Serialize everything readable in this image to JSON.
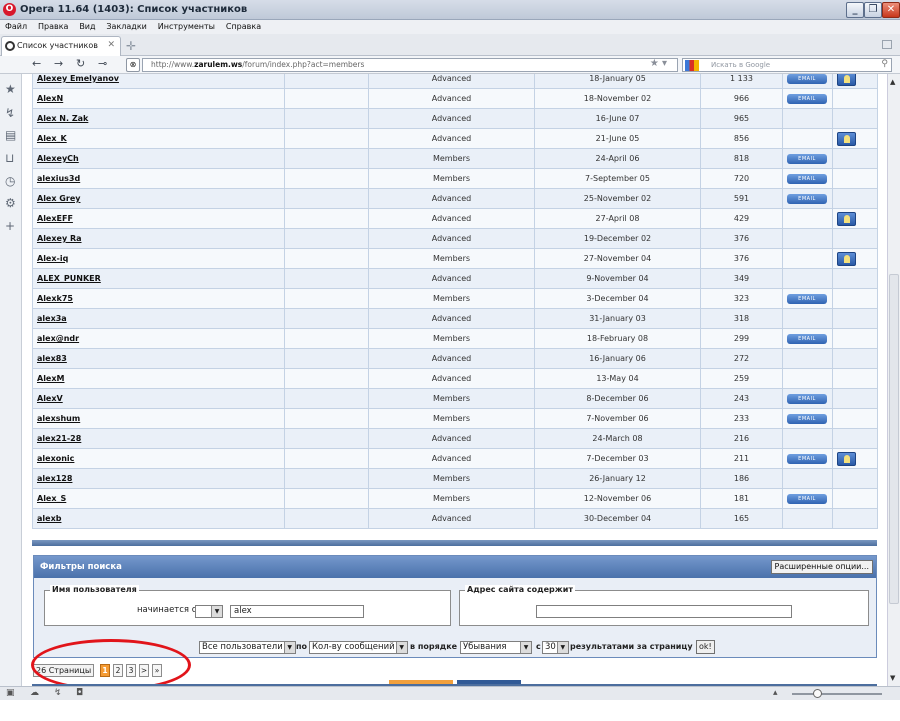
{
  "window": {
    "title": "Opera 11.64 (1403): Список участников"
  },
  "menu": [
    "Файл",
    "Правка",
    "Вид",
    "Закладки",
    "Инструменты",
    "Справка"
  ],
  "tab": {
    "title": "Список участников"
  },
  "address": {
    "url_prefix": "http://www.",
    "url_domain": "zarulem.ws",
    "url_path": "/forum/index.php?act=members",
    "search_placeholder": "Искать в Google"
  },
  "members": [
    {
      "name": "Alexey Emelyanov",
      "group": "Advanced",
      "joined": "18-January 05",
      "posts": "1 133",
      "email": true,
      "pm": true
    },
    {
      "name": "AlexN",
      "group": "Advanced",
      "joined": "18-November 02",
      "posts": "966",
      "email": true,
      "pm": false
    },
    {
      "name": "Alex N. Zak",
      "group": "Advanced",
      "joined": "16-June 07",
      "posts": "965",
      "email": false,
      "pm": false
    },
    {
      "name": "Alex_K",
      "group": "Advanced",
      "joined": "21-June 05",
      "posts": "856",
      "email": false,
      "pm": true
    },
    {
      "name": "AlexeyCh",
      "group": "Members",
      "joined": "24-April 06",
      "posts": "818",
      "email": true,
      "pm": false
    },
    {
      "name": "alexius3d",
      "group": "Members",
      "joined": "7-September 05",
      "posts": "720",
      "email": true,
      "pm": false
    },
    {
      "name": "Alex Grey",
      "group": "Advanced",
      "joined": "25-November 02",
      "posts": "591",
      "email": true,
      "pm": false
    },
    {
      "name": "AlexEFF",
      "group": "Advanced",
      "joined": "27-April 08",
      "posts": "429",
      "email": false,
      "pm": true
    },
    {
      "name": "Alexey Ra",
      "group": "Advanced",
      "joined": "19-December 02",
      "posts": "376",
      "email": false,
      "pm": false
    },
    {
      "name": "Alex-iq",
      "group": "Members",
      "joined": "27-November 04",
      "posts": "376",
      "email": false,
      "pm": true
    },
    {
      "name": "ALEX_PUNKER",
      "group": "Advanced",
      "joined": "9-November 04",
      "posts": "349",
      "email": false,
      "pm": false
    },
    {
      "name": "Alexk75",
      "group": "Members",
      "joined": "3-December 04",
      "posts": "323",
      "email": true,
      "pm": false
    },
    {
      "name": "alex3a",
      "group": "Advanced",
      "joined": "31-January 03",
      "posts": "318",
      "email": false,
      "pm": false
    },
    {
      "name": "alex@ndr",
      "group": "Members",
      "joined": "18-February 08",
      "posts": "299",
      "email": true,
      "pm": false
    },
    {
      "name": "alex83",
      "group": "Advanced",
      "joined": "16-January 06",
      "posts": "272",
      "email": false,
      "pm": false
    },
    {
      "name": "AlexM",
      "group": "Advanced",
      "joined": "13-May 04",
      "posts": "259",
      "email": false,
      "pm": false
    },
    {
      "name": "AlexV",
      "group": "Members",
      "joined": "8-December 06",
      "posts": "243",
      "email": true,
      "pm": false
    },
    {
      "name": "alexshum",
      "group": "Members",
      "joined": "7-November 06",
      "posts": "233",
      "email": true,
      "pm": false
    },
    {
      "name": "alex21-28",
      "group": "Advanced",
      "joined": "24-March 08",
      "posts": "216",
      "email": false,
      "pm": false
    },
    {
      "name": "alexonic",
      "group": "Advanced",
      "joined": "7-December 03",
      "posts": "211",
      "email": true,
      "pm": true
    },
    {
      "name": "alex128",
      "group": "Members",
      "joined": "26-January 12",
      "posts": "186",
      "email": false,
      "pm": false
    },
    {
      "name": "Alex_S",
      "group": "Members",
      "joined": "12-November 06",
      "posts": "181",
      "email": true,
      "pm": false
    },
    {
      "name": "alexb",
      "group": "Advanced",
      "joined": "30-December 04",
      "posts": "165",
      "email": false,
      "pm": false
    }
  ],
  "email_label": "EMAIL",
  "filters": {
    "title": "Фильтры поиска",
    "advanced_button": "Расширенные опции...",
    "username_legend": "Имя пользователя",
    "starts_with_label": "начинается с",
    "username_value": "alex",
    "website_legend": "Адрес сайта содержит",
    "website_value": "",
    "group_select": "Все пользователи",
    "by_label": "по",
    "sort_select": "Кол-ву сообщений",
    "order_label": "в порядке",
    "order_select": "Убывания",
    "with_label": "с",
    "per_page_select": "30",
    "per_page_label": "результатами за страницу",
    "ok_button": "ok!"
  },
  "pager": {
    "pages_label": "26 Страницы",
    "pages": [
      "1",
      "2",
      "3"
    ],
    "active_page": "1",
    "next": ">",
    "last": "»"
  },
  "colors": {
    "table_header": "#4a71ab",
    "pager_active": "#f59b33",
    "highlight_circle": "#e1141a"
  }
}
